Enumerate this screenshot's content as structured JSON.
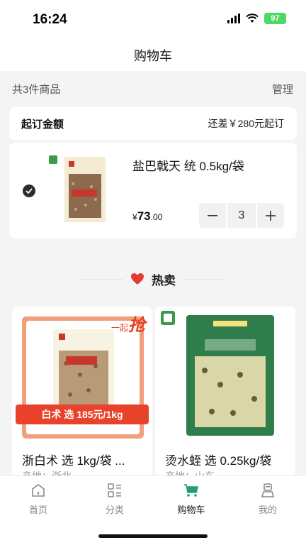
{
  "status_bar": {
    "time": "16:24",
    "battery": "97"
  },
  "nav": {
    "title": "购物车"
  },
  "summary": {
    "count_text": "共3件商品",
    "manage_label": "管理"
  },
  "min_order": {
    "label": "起订金额",
    "gap_text": "还差￥280元起订"
  },
  "cart_item": {
    "name": "盐巴戟天 统 0.5kg/袋",
    "price_symbol": "¥",
    "price_integer": "73",
    "price_decimal": ".00",
    "quantity": "3",
    "checked": true
  },
  "hot_section": {
    "title": "热卖"
  },
  "hot_items": [
    {
      "name": "浙白术 选 1kg/袋 ...",
      "origin": "产地：浙北",
      "promo": "白术 选 185元/1kg",
      "badge_small": "一起",
      "badge_big": "抢"
    },
    {
      "name": "烫水蛭 选 0.25kg/袋",
      "origin": "产地：山东"
    }
  ],
  "tabbar": {
    "items": [
      {
        "label": "首页",
        "icon": "home-icon"
      },
      {
        "label": "分类",
        "icon": "category-icon"
      },
      {
        "label": "购物车",
        "icon": "cart-icon",
        "active": true
      },
      {
        "label": "我的",
        "icon": "profile-icon"
      }
    ]
  },
  "colors": {
    "accent": "#22a06b",
    "promo_red": "#e8422a",
    "check_dark": "#2a2d2f"
  }
}
